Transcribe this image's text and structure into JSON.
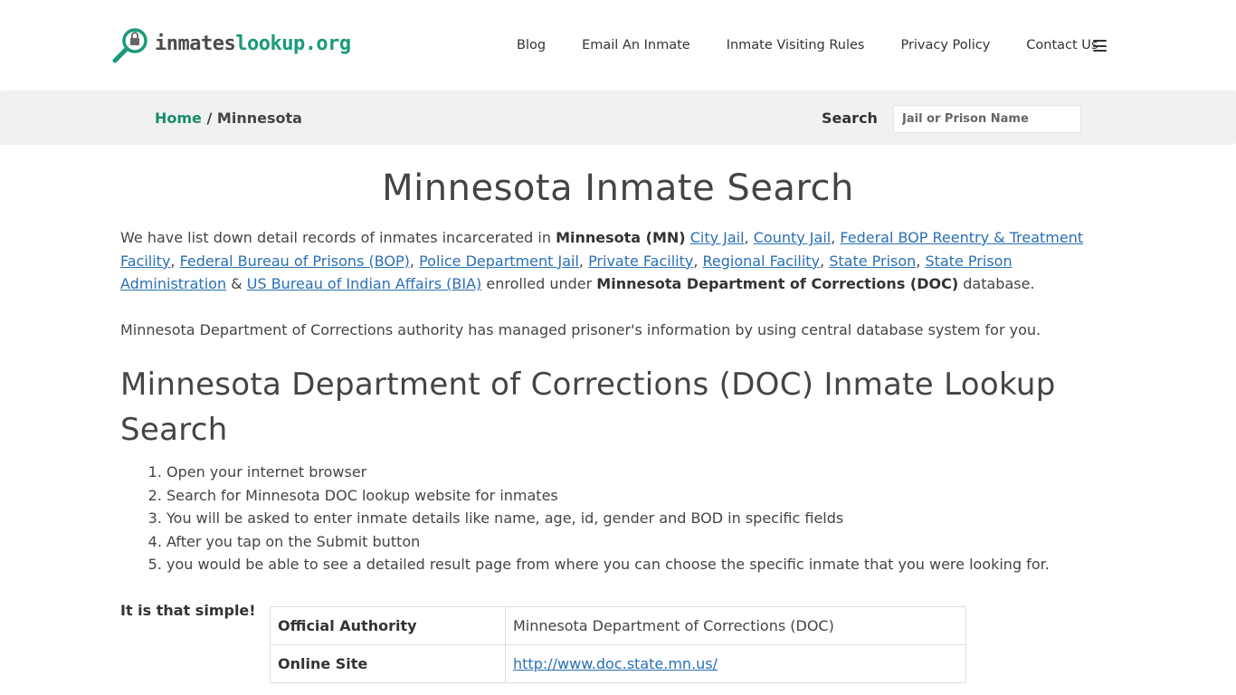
{
  "header": {
    "logo_part1": "inmates",
    "logo_part2": "lookup.org",
    "nav": [
      "Blog",
      "Email An Inmate",
      "Inmate Visiting Rules",
      "Privacy Policy",
      "Contact Us"
    ]
  },
  "breadcrumb": {
    "home": "Home",
    "separator": "/",
    "current": "Minnesota"
  },
  "search": {
    "label": "Search",
    "placeholder": "Jail or Prison Name"
  },
  "main": {
    "title": "Minnesota Inmate Search",
    "intro": {
      "lead": "We have list down detail records of inmates incarcerated in",
      "state": "Minnesota (MN)",
      "links": [
        "City Jail",
        "County Jail",
        "Federal BOP Reentry & Treatment Facility",
        "Federal Bureau of Prisons (BOP)",
        "Police Department Jail",
        "Private Facility",
        "Regional Facility",
        "State Prison",
        "State Prison Administration",
        "US Bureau of Indian Affairs (BIA)"
      ],
      "amp": "&",
      "tail1": "enrolled under",
      "doc": "Minnesota Department of Corrections (DOC)",
      "tail2": "database."
    },
    "note": "Minnesota Department of Corrections authority has managed prisoner's information by using central database system for you.",
    "subtitle": "Minnesota Department of Corrections (DOC) Inmate Lookup Search",
    "steps": [
      "Open your internet browser",
      "Search for Minnesota DOC lookup website for inmates",
      "You will be asked to enter inmate details like name, age, id, gender and BOD in specific fields",
      "After you tap on the Submit button",
      "you would be able to see a detailed result page from where you can choose the specific inmate that you were looking for."
    ],
    "simple": "It is that simple!"
  },
  "info_table": [
    {
      "key": "Official Authority",
      "value": "Minnesota Department of Corrections (DOC)",
      "link": false
    },
    {
      "key": "Online Site",
      "value": "http://www.doc.state.mn.us/",
      "link": true
    }
  ],
  "colors": {
    "accent": "#1a8c6e",
    "link": "#2a6fb5",
    "crumb_bg": "#f1f1f1"
  }
}
